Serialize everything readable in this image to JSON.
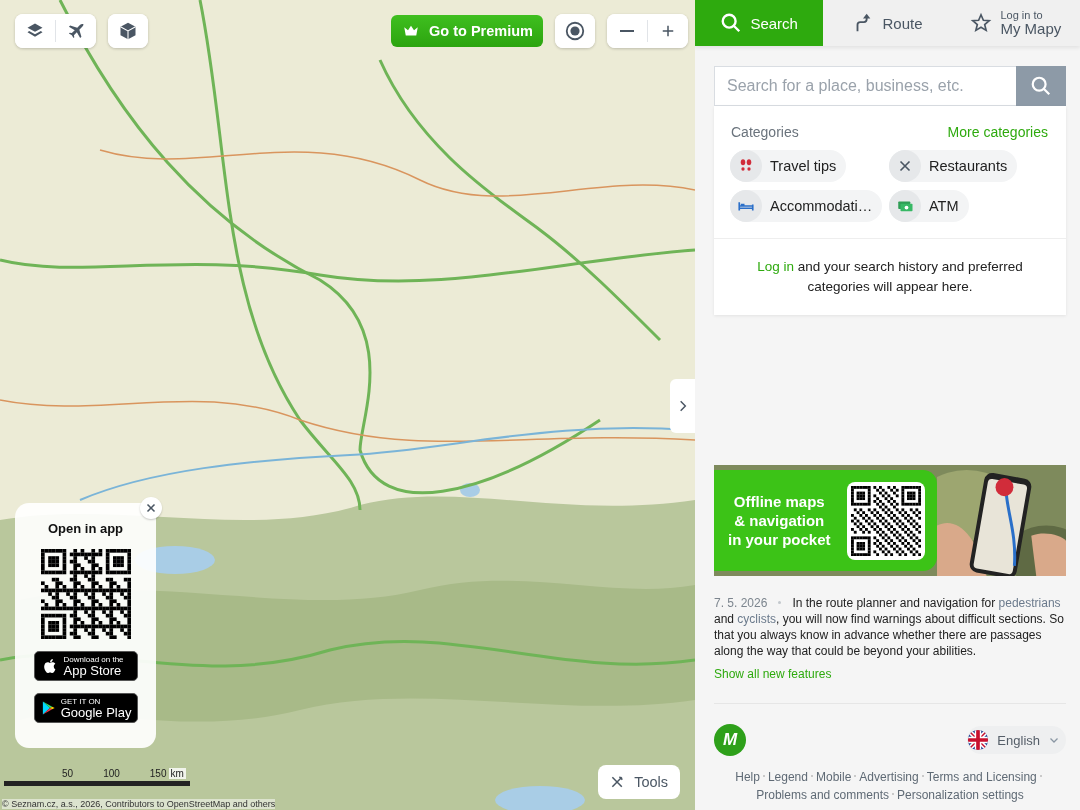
{
  "map_controls": {
    "premium_label": "Go to Premium",
    "tools_label": "Tools"
  },
  "app_promo": {
    "title": "Open in app",
    "app_store": {
      "small": "Download on the",
      "big": "App Store"
    },
    "google_play": {
      "small": "GET IT ON",
      "big": "Google Play"
    }
  },
  "scale": {
    "labels": [
      "50",
      "100",
      "150"
    ],
    "unit": "km"
  },
  "attribution": "© Seznam.cz, a.s., 2026, Contributors to OpenStreetMap and others",
  "tabs": [
    {
      "label": "Search",
      "selected": true
    },
    {
      "label": "Route",
      "selected": false
    },
    {
      "over": "Log in to",
      "label": "My Mapy",
      "selected": false
    }
  ],
  "search": {
    "placeholder": "Search for a place, business, etc."
  },
  "categories": {
    "title": "Categories",
    "more": "More categories",
    "items": [
      {
        "label": "Travel tips"
      },
      {
        "label": "Restaurants"
      },
      {
        "label": "Accommodati…"
      },
      {
        "label": "ATM"
      }
    ]
  },
  "login_hint": {
    "link": "Log in",
    "text": " and your search history and preferred categories will appear here."
  },
  "banner": {
    "lines": [
      "Offline maps",
      "& navigation",
      "in your pocket"
    ]
  },
  "news": {
    "date": "7. 5. 2026",
    "parts": [
      {
        "kind": "text",
        "text": "In the route planner and navigation for "
      },
      {
        "kind": "link",
        "text": "pedestrians"
      },
      {
        "kind": "text",
        "text": " and "
      },
      {
        "kind": "link",
        "text": "cyclists"
      },
      {
        "kind": "text",
        "text": ", you will now find warnings about difficult sections. So that you always know in advance whether there are passages along the way that could be beyond your abilities."
      }
    ],
    "more": "Show all new features"
  },
  "logo_letter": "M",
  "language": "English",
  "footer_links": [
    "Help",
    "Legend",
    "Mobile",
    "Advertising",
    "Terms and Licensing",
    "Problems and comments",
    "Personalization settings"
  ]
}
